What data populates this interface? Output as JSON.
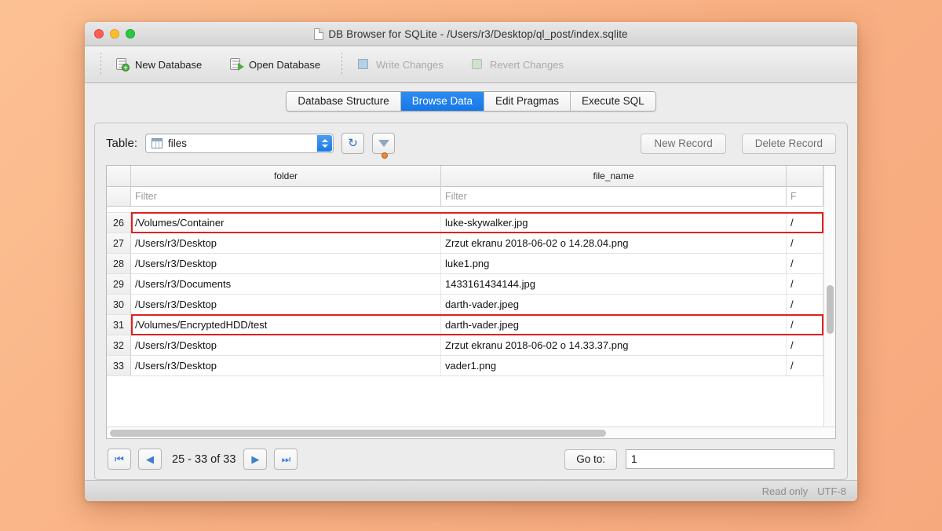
{
  "window": {
    "title": "DB Browser for SQLite - /Users/r3/Desktop/ql_post/index.sqlite",
    "doc_icon": "document-icon"
  },
  "toolbar": {
    "items": [
      {
        "label": "New Database",
        "icon": "new-database-icon",
        "disabled": false
      },
      {
        "label": "Open Database",
        "icon": "open-database-icon",
        "disabled": false
      },
      {
        "label": "Write Changes",
        "icon": "write-changes-icon",
        "disabled": true
      },
      {
        "label": "Revert Changes",
        "icon": "revert-changes-icon",
        "disabled": true
      }
    ]
  },
  "tabs": [
    {
      "label": "Database Structure",
      "active": false
    },
    {
      "label": "Browse Data",
      "active": true
    },
    {
      "label": "Edit Pragmas",
      "active": false
    },
    {
      "label": "Execute SQL",
      "active": false
    }
  ],
  "table_selector": {
    "label": "Table:",
    "value": "files",
    "table_icon": "table-grid-icon",
    "refresh_icon": "refresh-icon",
    "clear_filter_icon": "clear-filter-icon"
  },
  "record_buttons": {
    "new_record": "New Record",
    "delete_record": "Delete Record"
  },
  "grid": {
    "columns": [
      "folder",
      "file_name"
    ],
    "third_column_partial": "F",
    "filter_placeholder": "Filter",
    "rows": [
      {
        "num": "26",
        "folder": "/Volumes/Container",
        "file_name": "luke-skywalker.jpg",
        "third": "/",
        "highlighted": true
      },
      {
        "num": "27",
        "folder": "/Users/r3/Desktop",
        "file_name": "Zrzut ekranu 2018-06-02 o 14.28.04.png",
        "third": "/",
        "highlighted": false
      },
      {
        "num": "28",
        "folder": "/Users/r3/Desktop",
        "file_name": "luke1.png",
        "third": "/",
        "highlighted": false
      },
      {
        "num": "29",
        "folder": "/Users/r3/Documents",
        "file_name": "1433161434144.jpg",
        "third": "/",
        "highlighted": false
      },
      {
        "num": "30",
        "folder": "/Users/r3/Desktop",
        "file_name": "darth-vader.jpeg",
        "third": "/",
        "highlighted": false
      },
      {
        "num": "31",
        "folder": "/Volumes/EncryptedHDD/test",
        "file_name": "darth-vader.jpeg",
        "third": "/",
        "highlighted": true
      },
      {
        "num": "32",
        "folder": "/Users/r3/Desktop",
        "file_name": "Zrzut ekranu 2018-06-02 o 14.33.37.png",
        "third": "/",
        "highlighted": false
      },
      {
        "num": "33",
        "folder": "/Users/r3/Desktop",
        "file_name": "vader1.png",
        "third": "/",
        "highlighted": false
      }
    ],
    "highlight_color": "#e02020"
  },
  "pager": {
    "first_icon": "first-page-icon",
    "prev_icon": "previous-page-icon",
    "range_text": "25 - 33 of 33",
    "next_icon": "next-page-icon",
    "last_icon": "last-page-icon",
    "goto_label": "Go to:",
    "goto_value": "1"
  },
  "statusbar": {
    "read_only": "Read only",
    "encoding": "UTF-8"
  }
}
